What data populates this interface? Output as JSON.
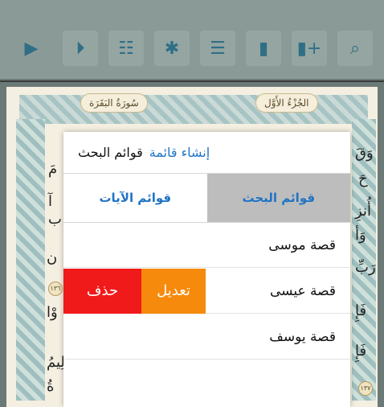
{
  "toolbar": {
    "buttons": [
      {
        "icon": "play-icon",
        "glyph": "▶"
      },
      {
        "icon": "fast-forward-icon",
        "glyph": "⏵"
      },
      {
        "icon": "reciter-icon",
        "glyph": "☷"
      },
      {
        "icon": "settings-gear-icon",
        "glyph": "✱"
      },
      {
        "icon": "list-icon",
        "glyph": "☰"
      },
      {
        "icon": "bookmarks-icon",
        "glyph": "▮"
      },
      {
        "icon": "add-bookmark-icon",
        "glyph": "▮+"
      },
      {
        "icon": "search-icon",
        "glyph": "⌕"
      }
    ]
  },
  "mushaf": {
    "surah_name": "سُورَةُ البَقَرَة",
    "juz_name": "الجُزْءُ الأَوَّل"
  },
  "popup": {
    "title": "قوائم البحث",
    "create_link": "إنشاء قائمة",
    "tabs": {
      "search_lists": "قوائم البحث",
      "verse_lists": "قوائم الآيات"
    },
    "items": [
      {
        "label": "قصة موسى"
      },
      {
        "label": "قصة عيسى",
        "edit_label": "تعديل",
        "delete_label": "حذف"
      },
      {
        "label": "قصة يوسف"
      }
    ]
  },
  "colors": {
    "accent_blue": "#1f73c4",
    "edit_orange": "#f68a0d",
    "delete_red": "#f11a1a",
    "active_tab_gray": "#bdbdbd"
  }
}
